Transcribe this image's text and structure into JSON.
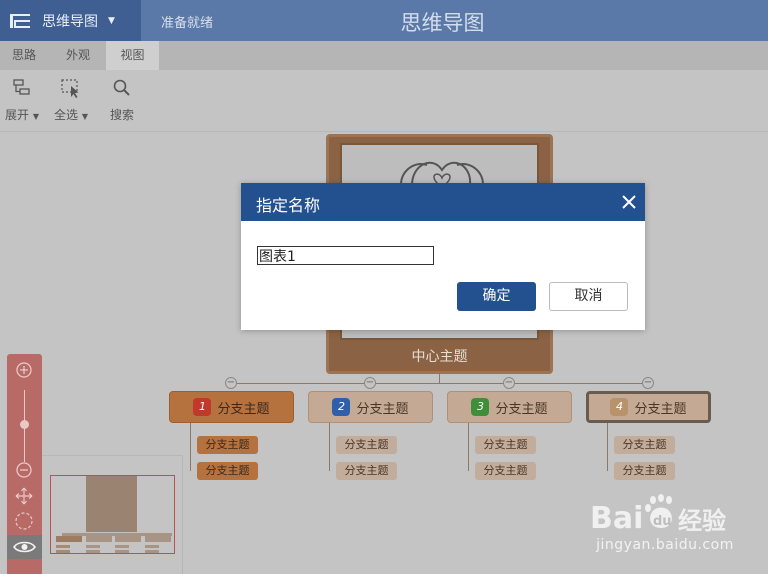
{
  "app": {
    "name": "思维导图",
    "status": "准备就绪",
    "doc_title": "思维导图"
  },
  "tabs": [
    {
      "label": "思路"
    },
    {
      "label": "外观"
    },
    {
      "label": "视图",
      "active": true
    }
  ],
  "toolbar": {
    "expand_label": "展开",
    "select_all_label": "全选",
    "search_label": "搜索"
  },
  "mindmap": {
    "center_topic": "中心主题",
    "branches": [
      {
        "num": "1",
        "label": "分支主题",
        "num_color": "#c0392b"
      },
      {
        "num": "2",
        "label": "分支主题",
        "num_color": "#2f5fa8"
      },
      {
        "num": "3",
        "label": "分支主题",
        "num_color": "#3f8f3a"
      },
      {
        "num": "4",
        "label": "分支主题",
        "num_color": "#b8926a"
      }
    ],
    "sub_label": "分支主题"
  },
  "dialog": {
    "title": "指定名称",
    "input_value": "图表1",
    "ok_label": "确定",
    "cancel_label": "取消"
  },
  "colors": {
    "title_bar": "#5b79a8",
    "dialog_header": "#23508f",
    "accent_brown": "#b5713e",
    "zoom_panel": "#b86a67"
  }
}
